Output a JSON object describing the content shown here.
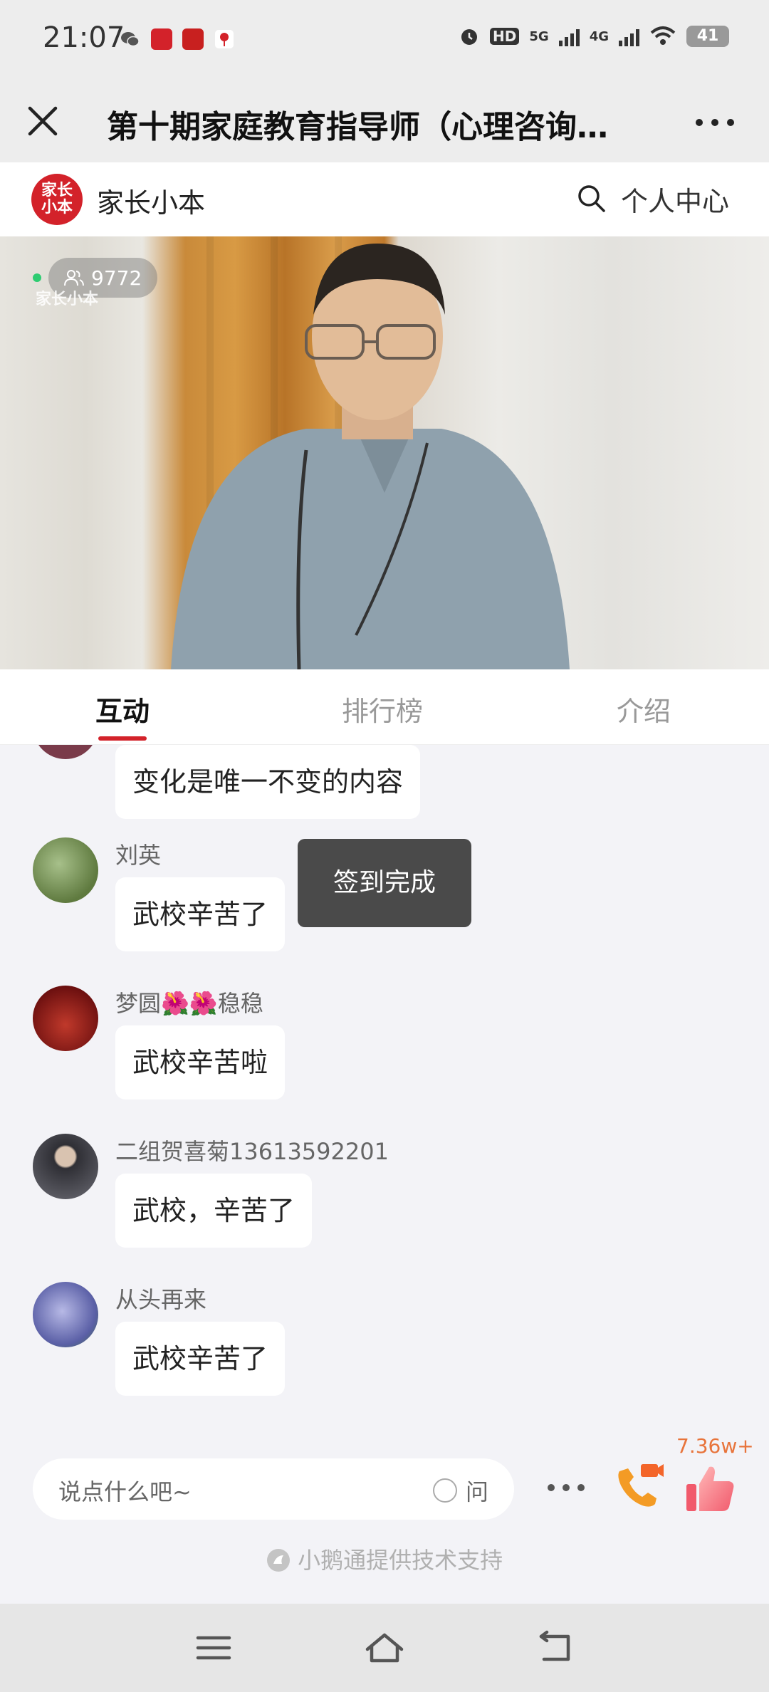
{
  "status_bar": {
    "time": "21:07",
    "hd_label": "HD",
    "net1": "5G",
    "net2": "4G",
    "battery": "41"
  },
  "title_bar": {
    "title": "第十期家庭教育指导师（心理咨询…"
  },
  "brand": {
    "logo_text_line1": "家长",
    "logo_text_line2": "小本",
    "name": "家长小本",
    "personal_center": "个人中心",
    "accent_color": "#d3222a"
  },
  "video": {
    "viewer_count": "9772",
    "watermark": "家长小本"
  },
  "tabs": [
    {
      "label": "互动",
      "active": true
    },
    {
      "label": "排行榜",
      "active": false
    },
    {
      "label": "介绍",
      "active": false
    }
  ],
  "messages": [
    {
      "name": "",
      "text": "变化是唯一不变的内容",
      "avatar_color": "#7a3b4a"
    },
    {
      "name": "刘英",
      "text": "武校辛苦了",
      "avatar_color": "#6e8c4a"
    },
    {
      "name": "梦圆🌺🌺稳稳",
      "text": "武校辛苦啦",
      "avatar_color": "#9b1b1b"
    },
    {
      "name": "二组贺喜菊13613592201",
      "text": "武校，辛苦了",
      "avatar_color": "#555560"
    },
    {
      "name": "从头再来",
      "text": "武校辛苦了",
      "avatar_color": "#6a6fb0"
    }
  ],
  "toast": "签到完成",
  "input_bar": {
    "placeholder": "说点什么吧~",
    "ask_label": "问",
    "like_count": "7.36w+",
    "powered_by": "小鹅通提供技术支持"
  }
}
